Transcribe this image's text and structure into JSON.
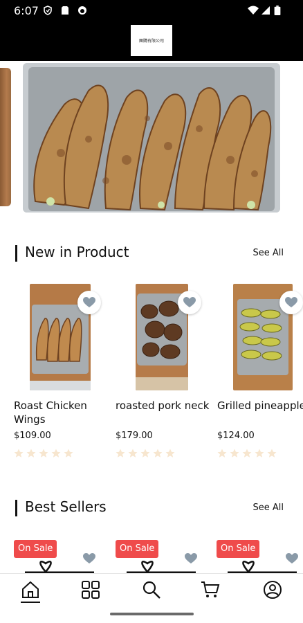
{
  "status_bar": {
    "time": "6:07",
    "icons": [
      "shield-icon",
      "sim-card-icon",
      "circle-status-icon",
      "wifi-icon",
      "signal-icon",
      "battery-icon"
    ]
  },
  "header": {
    "logo_text": "團購有限公司"
  },
  "sections": {
    "new_products": {
      "title": "New in Product",
      "see_all": "See All"
    },
    "best_sellers": {
      "title": "Best Sellers",
      "see_all": "See All"
    }
  },
  "products": [
    {
      "name": "Roast Chicken Wings",
      "price": "$109.00",
      "rating": 0,
      "rating_max": 5
    },
    {
      "name": "roasted pork neck",
      "price": "$179.00",
      "rating": 0,
      "rating_max": 5
    },
    {
      "name": "Grilled pineapple",
      "price": "$124.00",
      "rating": 0,
      "rating_max": 5
    }
  ],
  "best_sellers": [
    {
      "badge": "On Sale"
    },
    {
      "badge": "On Sale"
    },
    {
      "badge": "On Sale"
    }
  ],
  "bottom_nav": [
    "home-icon",
    "categories-icon",
    "search-icon",
    "cart-icon",
    "profile-icon"
  ],
  "colors": {
    "sale_badge": "#ef4b4b",
    "star_empty": "#f7e6cf",
    "heart": "#8a9aa8",
    "header_bg": "#000000"
  }
}
